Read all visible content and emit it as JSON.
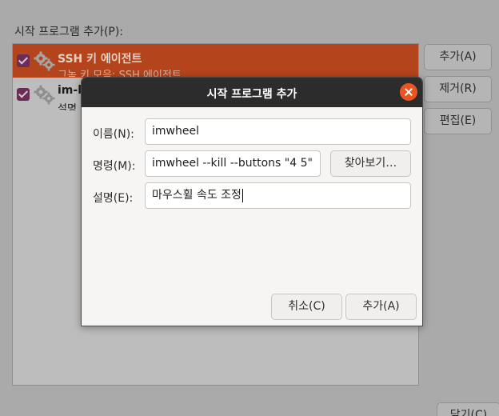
{
  "background": {
    "title": "시작 프로그램 추가(P):",
    "items": [
      {
        "name": "SSH 키 에이전트",
        "description": "그놈 키 모음: SSH 에이전트",
        "checked": true,
        "selected": true
      },
      {
        "name": "im-la",
        "description": "설명",
        "checked": true,
        "selected": false
      }
    ],
    "buttons": {
      "add": "추가(A)",
      "remove": "제거(R)",
      "edit": "편집(E)",
      "close": "닫기(C)"
    }
  },
  "dialog": {
    "title": "시작 프로그램 추가",
    "fields": {
      "name_label": "이름(N):",
      "name_value": "imwheel",
      "command_label": "명령(M):",
      "command_value": "imwheel --kill --buttons \"4 5\"",
      "comment_label": "설명(E):",
      "comment_value": "마우스휠 속도 조정"
    },
    "browse_label": "찾아보기…",
    "cancel_label": "취소(C)",
    "add_label": "추가(A)"
  },
  "colors": {
    "accent": "#e95420",
    "header_bar": "#2c2c2c",
    "checkbox": "#6b2d55"
  }
}
